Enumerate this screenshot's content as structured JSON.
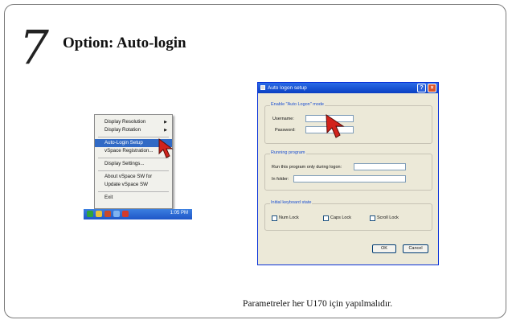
{
  "header": {
    "step_number": "7",
    "title": "Option: Auto-login"
  },
  "context_menu": {
    "items": [
      {
        "label": "Display Resolution",
        "submenu": true
      },
      {
        "label": "Display Rotation",
        "submenu": true
      },
      {
        "label": "Auto-Login Setup",
        "highlighted": true
      },
      {
        "label": "vSpace Registration..."
      },
      {
        "label": "Display Settings..."
      },
      {
        "label": "About vSpace SW for"
      },
      {
        "label": "Update vSpace SW"
      },
      {
        "label": "Exit"
      }
    ],
    "submenu_arrow": "▶"
  },
  "taskbar": {
    "time": "1:05 PM"
  },
  "dialog": {
    "title": "Auto logon setup",
    "help_button": "?",
    "close_button": "×",
    "enable_group": {
      "label": "Enable \"Auto Logon\" mode",
      "username_label": "Username:",
      "username_value": "",
      "password_label": "Password:",
      "password_value": ""
    },
    "running_group": {
      "label": "Running program",
      "run_label": "Run this program only during logon:",
      "run_value": "",
      "folder_label": "In folder:",
      "folder_value": ""
    },
    "keyboard_group": {
      "label": "Initial keyboard state",
      "num_lock": "Num Lock",
      "caps_lock": "Caps Lock",
      "scroll_lock": "Scroll Lock"
    },
    "ok_label": "OK",
    "cancel_label": "Cancel"
  },
  "footer_note": "Parametreler her U170 için yapılmalıdır.",
  "colors": {
    "highlight": "#316ac5",
    "taskbar": "#245edb",
    "titlebar": "#0a3fc2",
    "pointer": "#d2231c"
  },
  "icons": [
    "cursor-pointer-icon",
    "app-icon",
    "help-icon",
    "close-icon",
    "tray-icon"
  ]
}
